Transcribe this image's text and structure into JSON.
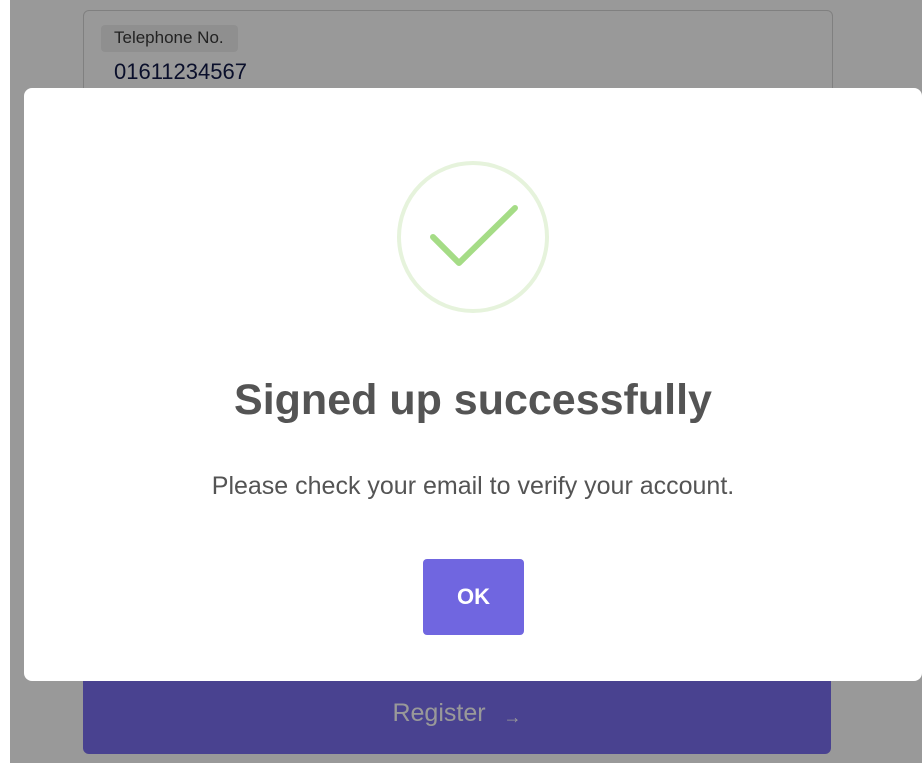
{
  "form": {
    "telephone_label": "Telephone No.",
    "telephone_value": "01611234567",
    "register_label": "Register",
    "register_arrow": "→"
  },
  "modal": {
    "icon": "success-check-icon",
    "title": "Signed up successfully",
    "text": "Please check your email to verify your account.",
    "ok_label": "OK"
  },
  "colors": {
    "accent": "#7066e0",
    "success": "#a5dc86",
    "overlay": "rgba(0,0,0,0.40)",
    "text": "#545454"
  }
}
